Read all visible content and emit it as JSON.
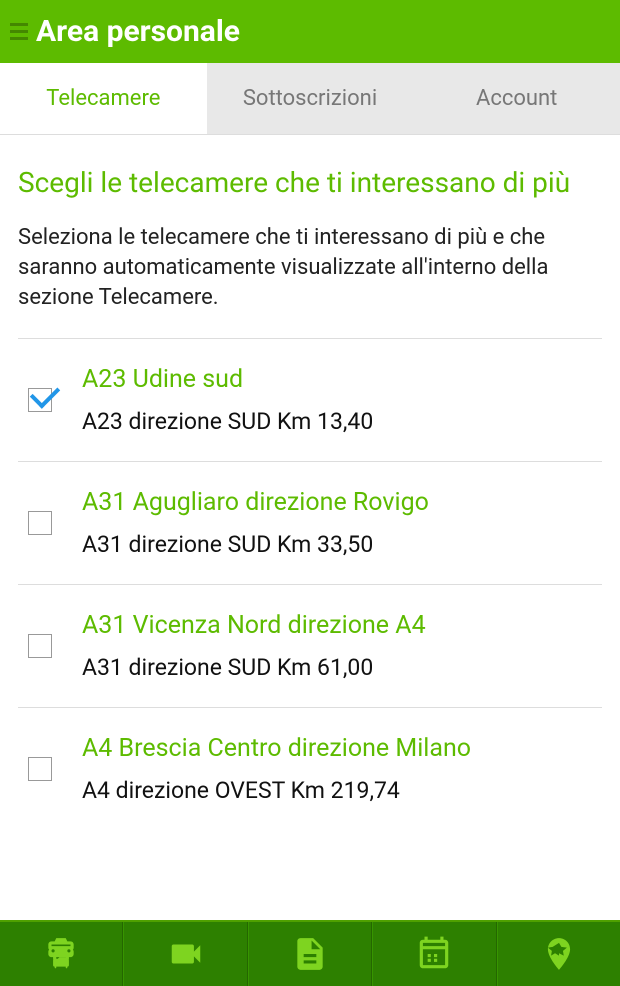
{
  "header": {
    "title": "Area personale"
  },
  "tabs": {
    "items": [
      {
        "label": "Telecamere",
        "active": true
      },
      {
        "label": "Sottoscrizioni",
        "active": false
      },
      {
        "label": "Account",
        "active": false
      }
    ]
  },
  "section": {
    "title": "Scegli le telecamere che ti interessano di più",
    "description": "Seleziona le telecamere che ti interessano di più e che saranno automaticamente visualizzate all'interno della sezione Telecamere."
  },
  "cameras": [
    {
      "title": "A23 Udine sud",
      "subtitle": "A23 direzione SUD Km 13,40",
      "checked": true
    },
    {
      "title": "A31 Agugliaro direzione Rovigo",
      "subtitle": "A31 direzione SUD Km 33,50",
      "checked": false
    },
    {
      "title": "A31 Vicenza Nord direzione A4",
      "subtitle": "A31 direzione SUD Km 61,00",
      "checked": false
    },
    {
      "title": "A4 Brescia Centro direzione Milano",
      "subtitle": "A4 direzione OVEST Km 219,74",
      "checked": false
    }
  ],
  "bottomNav": {
    "items": [
      "traffic",
      "camera",
      "document",
      "calendar",
      "favorite"
    ]
  }
}
